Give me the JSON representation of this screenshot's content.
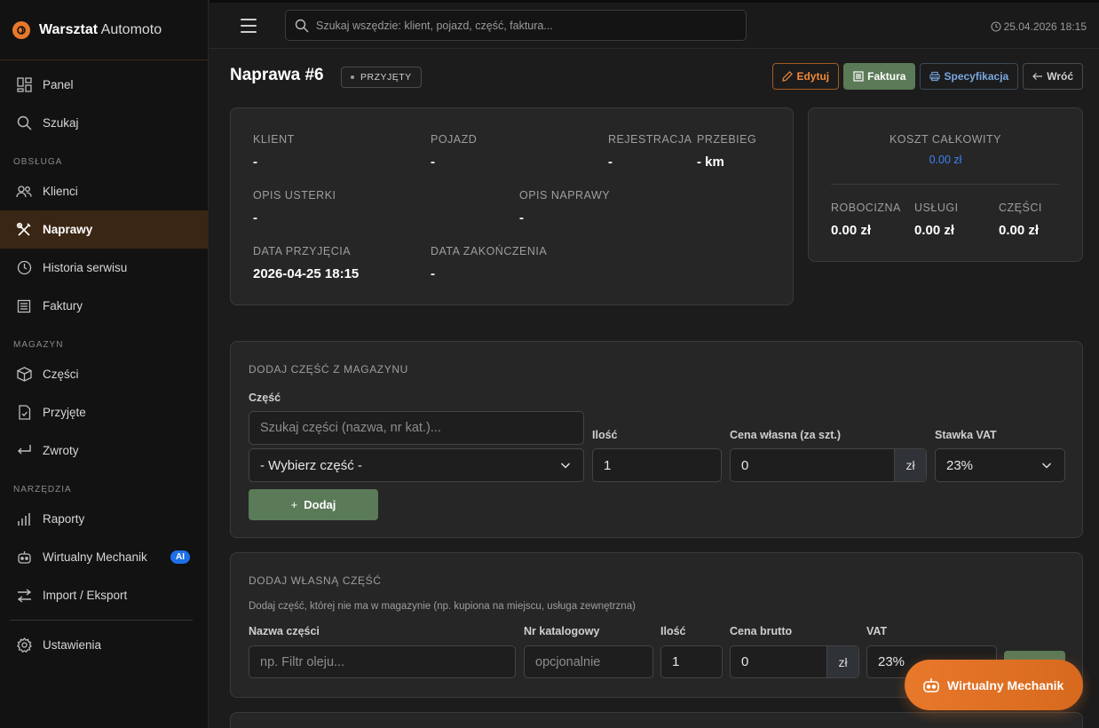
{
  "brand": {
    "name_bold": "Warsztat",
    "name_light": "Automoto"
  },
  "sidebar": {
    "items": [
      {
        "label": "Panel"
      },
      {
        "label": "Szukaj"
      },
      {
        "label": "Klienci"
      },
      {
        "label": "Naprawy"
      },
      {
        "label": "Historia serwisu"
      },
      {
        "label": "Faktury"
      },
      {
        "label": "Części"
      },
      {
        "label": "Przyjęte"
      },
      {
        "label": "Zwroty"
      },
      {
        "label": "Raporty"
      },
      {
        "label": "Wirtualny Mechanik",
        "badge": "AI"
      },
      {
        "label": "Import / Eksport"
      },
      {
        "label": "Ustawienia"
      }
    ],
    "sections": [
      "OBSŁUGA",
      "MAGAZYN",
      "NARZĘDZIA"
    ],
    "active_index": 3
  },
  "topbar": {
    "search_placeholder": "Szukaj wszędzie: klient, pojazd, część, faktura...",
    "datetime": "25.04.2026 18:15"
  },
  "header": {
    "title": "Naprawa #6",
    "status": "PRZYJĘTY",
    "buttons": {
      "edit": "Edytuj",
      "invoice": "Faktura",
      "spec": "Specyfikacja",
      "back": "Wróć"
    }
  },
  "info": {
    "client_label": "KLIENT",
    "client_value": "-",
    "vehicle_label": "POJAZD",
    "vehicle_value": "-",
    "reg_label": "REJESTRACJA",
    "reg_value": "-",
    "mileage_label": "PRZEBIEG",
    "mileage_value": "- km",
    "fault_label": "OPIS USTERKI",
    "fault_value": "-",
    "repair_label": "OPIS NAPRAWY",
    "repair_value": "-",
    "accept_label": "DATA PRZYJĘCIA",
    "accept_value": "2026-04-25 18:15",
    "finish_label": "DATA ZAKOŃCZENIA",
    "finish_value": "-"
  },
  "cost": {
    "title": "KOSZT CAŁKOWITY",
    "total": "0.00 zł",
    "labor_label": "ROBOCIZNA",
    "labor_value": "0.00 zł",
    "services_label": "USŁUGI",
    "services_value": "0.00 zł",
    "parts_label": "CZĘŚCI",
    "parts_value": "0.00 zł"
  },
  "add_stock": {
    "title": "DODAJ CZĘŚĆ Z MAGAZYNU",
    "part_label": "Część",
    "search_placeholder": "Szukaj części (nazwa, nr kat.)...",
    "select_value": "- Wybierz część -",
    "qty_label": "Ilość",
    "qty_value": "1",
    "price_label": "Cena własna (za szt.)",
    "price_value": "0",
    "currency": "zł",
    "vat_label": "Stawka VAT",
    "vat_value": "23%",
    "add_button": "Dodaj"
  },
  "add_custom": {
    "title": "DODAJ WŁASNĄ CZĘŚĆ",
    "description": "Dodaj część, której nie ma w magazynie (np. kupiona na miejscu, usługa zewnętrzna)",
    "name_label": "Nazwa części",
    "name_placeholder": "np. Filtr oleju...",
    "cat_label": "Nr katalogowy",
    "cat_placeholder": "opcjonalnie",
    "qty_label": "Ilość",
    "qty_value": "1",
    "price_label": "Cena brutto",
    "price_value": "0",
    "currency": "zł",
    "vat_label": "VAT",
    "vat_value": "23%"
  },
  "fab": {
    "label": "Wirtualny Mechanik"
  }
}
